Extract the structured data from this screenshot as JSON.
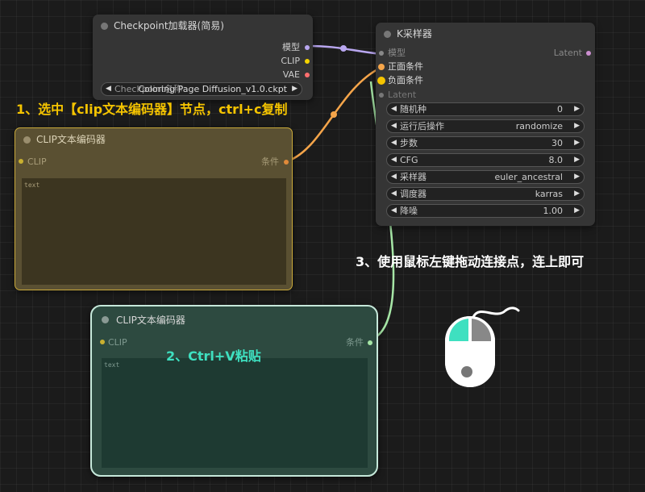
{
  "checkpoint_node": {
    "title": "Checkpoint加载器(简易)",
    "outputs": [
      "模型",
      "CLIP",
      "VAE"
    ],
    "widget_label": "Checkpoint名称",
    "widget_value": "Coloring Page Diffusion_v1.0.ckpt"
  },
  "ksampler_node": {
    "title": "K采样器",
    "inputs": [
      "模型",
      "正面条件",
      "负面条件",
      "Latent"
    ],
    "output": "Latent",
    "widgets": [
      {
        "label": "随机种",
        "value": "0"
      },
      {
        "label": "运行后操作",
        "value": "randomize"
      },
      {
        "label": "步数",
        "value": "30"
      },
      {
        "label": "CFG",
        "value": "8.0"
      },
      {
        "label": "采样器",
        "value": "euler_ancestral"
      },
      {
        "label": "调度器",
        "value": "karras"
      },
      {
        "label": "降噪",
        "value": "1.00"
      }
    ]
  },
  "clip_node_1": {
    "title": "CLIP文本编码器",
    "input": "CLIP",
    "output": "条件",
    "text_placeholder": "text"
  },
  "clip_node_2": {
    "title": "CLIP文本编码器",
    "input": "CLIP",
    "output": "条件",
    "text_placeholder": "text"
  },
  "annotations": {
    "step1": "1、选中【clip文本编码器】节点，ctrl+c复制",
    "step2": "2、Ctrl+V粘贴",
    "step3": "3、使用鼠标左键拖动连接点，连上即可"
  },
  "colors": {
    "step1": "#f5c400",
    "step2": "#3ee0c0",
    "step3": "#ffffff",
    "wire_model": "#b9a7f0",
    "wire_conditioning": "#f5a54a",
    "wire_new": "#a6e6a6"
  }
}
